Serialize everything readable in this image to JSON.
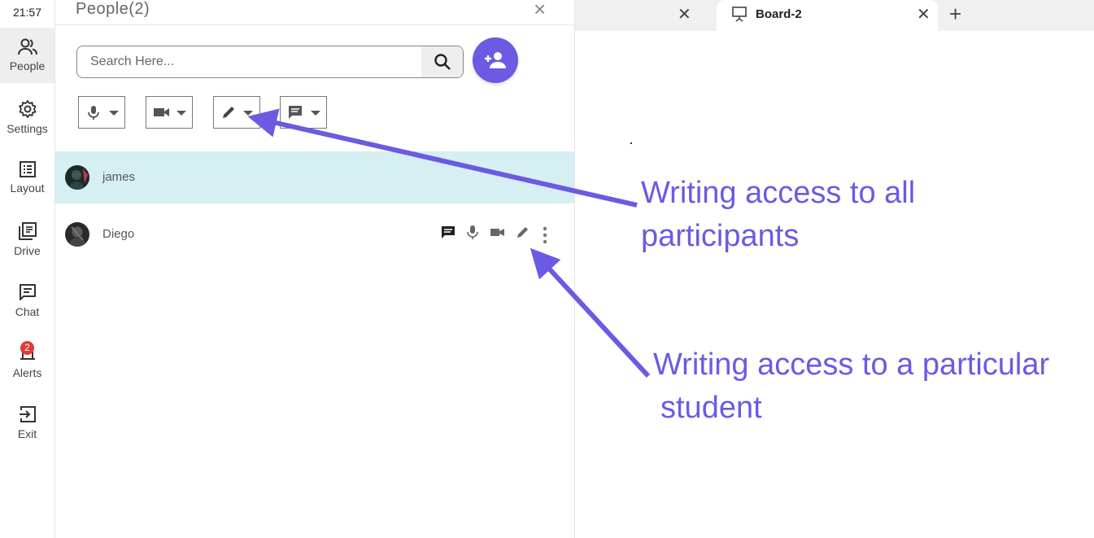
{
  "rail": {
    "time": "21:57",
    "items": [
      {
        "label": "People",
        "icon": "people-icon"
      },
      {
        "label": "Settings",
        "icon": "gear-icon"
      },
      {
        "label": "Layout",
        "icon": "layout-icon"
      },
      {
        "label": "Drive",
        "icon": "drive-icon"
      },
      {
        "label": "Chat",
        "icon": "chat-icon"
      },
      {
        "label": "Alerts",
        "icon": "bell-icon",
        "badge": "2"
      },
      {
        "label": "Exit",
        "icon": "exit-icon"
      }
    ]
  },
  "panel": {
    "title": "People(2)",
    "search_placeholder": "Search Here...",
    "controls": [
      "mic-icon",
      "video-icon",
      "pencil-icon",
      "chat-icon"
    ],
    "participants": [
      {
        "name": "james",
        "highlighted": true
      },
      {
        "name": "Diego",
        "highlighted": false,
        "icons": [
          "chat-icon",
          "mic-icon",
          "video-icon",
          "pencil-icon",
          "more-vert-icon"
        ]
      }
    ]
  },
  "tabs": {
    "items": [
      {
        "label": ""
      },
      {
        "label": "Board-2",
        "icon": "whiteboard-icon",
        "active": true
      }
    ]
  },
  "annotations": {
    "all_participants": [
      "Writing access to all",
      "participants"
    ],
    "particular_student": [
      "Writing access to a particular",
      "student"
    ],
    "color": "#6a5be2"
  },
  "colors": {
    "accent": "#6a5be2",
    "highlight_row": "#d6eff3",
    "badge": "#e53935"
  }
}
